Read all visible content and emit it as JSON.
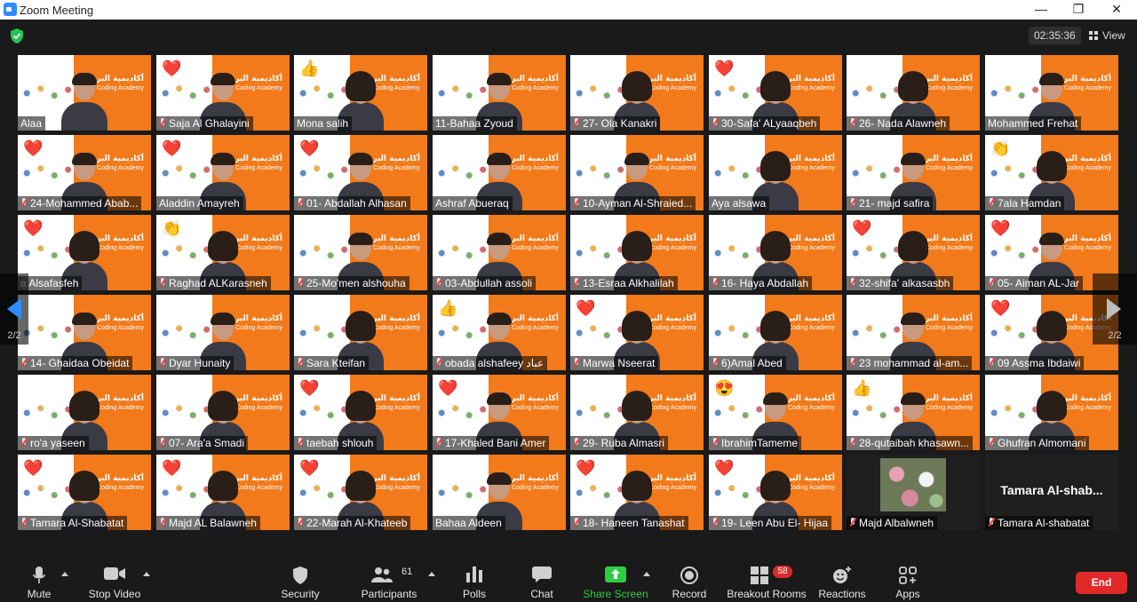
{
  "window": {
    "title": "Zoom Meeting",
    "minimize": "—",
    "maximize": "❐",
    "close": "✕"
  },
  "header": {
    "timer": "02:35:36",
    "view_label": "View"
  },
  "pager": {
    "page_label_left": "2/2",
    "page_label_right": "2/2"
  },
  "participants_grid": [
    [
      {
        "name": "Alaa",
        "muted": false,
        "reaction": ""
      },
      {
        "name": "Saja Al Ghalayini",
        "muted": true,
        "reaction": "❤️"
      },
      {
        "name": "Mona salih",
        "muted": false,
        "reaction": "👍",
        "hijab": true
      },
      {
        "name": "11-Bahaa Zyoud",
        "muted": false,
        "reaction": ""
      },
      {
        "name": "27- Ola Kanakri",
        "muted": true,
        "reaction": "",
        "hijab": true
      },
      {
        "name": "30-Safa' ALyaaqbeh",
        "muted": true,
        "reaction": "❤️",
        "hijab": true
      },
      {
        "name": "26- Nada Alawneh",
        "muted": true,
        "reaction": "",
        "hijab": true
      },
      {
        "name": "Mohammed Frehat",
        "muted": false,
        "reaction": ""
      }
    ],
    [
      {
        "name": "24-Mohammed Abab...",
        "muted": true,
        "reaction": "❤️"
      },
      {
        "name": "Aladdin Amayreh",
        "muted": false,
        "reaction": "❤️"
      },
      {
        "name": "01- Abdallah Alhasan",
        "muted": true,
        "reaction": "❤️"
      },
      {
        "name": "Ashraf Abueraq",
        "muted": false,
        "reaction": ""
      },
      {
        "name": "10-Ayman Al-Shraied...",
        "muted": true,
        "reaction": ""
      },
      {
        "name": "Aya alsawa",
        "muted": false,
        "reaction": "",
        "hijab": true
      },
      {
        "name": "21- majd safira",
        "muted": true,
        "reaction": ""
      },
      {
        "name": "7ala Hamdan",
        "muted": true,
        "reaction": "👏",
        "hijab": true
      }
    ],
    [
      {
        "name": "a Alsafasfeh",
        "muted": false,
        "reaction": "❤️",
        "hijab": true
      },
      {
        "name": "Raghad ALKarasneh",
        "muted": true,
        "reaction": "👏",
        "hijab": true
      },
      {
        "name": "25-Mo'men alshouha",
        "muted": true,
        "reaction": ""
      },
      {
        "name": "03-Abdullah assoli",
        "muted": true,
        "reaction": ""
      },
      {
        "name": "13-Esraa Alkhalilah",
        "muted": true,
        "reaction": "",
        "hijab": true
      },
      {
        "name": "16- Haya Abdallah",
        "muted": true,
        "reaction": "",
        "hijab": true
      },
      {
        "name": "32-shifa' alkasasbh",
        "muted": true,
        "reaction": "❤️",
        "hijab": true
      },
      {
        "name": "05- Aiman AL-Jar",
        "muted": true,
        "reaction": "❤️"
      }
    ],
    [
      {
        "name": "14- Ghaidaa Obeidat",
        "muted": true,
        "reaction": ""
      },
      {
        "name": "Dyar Hunaity",
        "muted": true,
        "reaction": ""
      },
      {
        "name": "Sara Kteifan",
        "muted": true,
        "reaction": "",
        "hijab": true
      },
      {
        "name": "obada alshafeey عباد",
        "muted": true,
        "reaction": "👍"
      },
      {
        "name": "Marwa Nseerat",
        "muted": true,
        "reaction": "❤️",
        "hijab": true
      },
      {
        "name": "6)Amal Abed",
        "muted": true,
        "reaction": "",
        "hijab": true
      },
      {
        "name": "23 mohammad al-am...",
        "muted": true,
        "reaction": ""
      },
      {
        "name": "09 Assma Ibdaiwi",
        "muted": true,
        "reaction": "❤️",
        "hijab": true
      }
    ],
    [
      {
        "name": "ro'a yaseen",
        "muted": true,
        "reaction": "",
        "hijab": true
      },
      {
        "name": "07- Ara'a Smadi",
        "muted": true,
        "reaction": "",
        "hijab": true
      },
      {
        "name": "taebah shlouh",
        "muted": true,
        "reaction": "❤️",
        "hijab": true
      },
      {
        "name": "17-Khaled Bani Amer",
        "muted": true,
        "reaction": "❤️"
      },
      {
        "name": "29- Ruba Almasri",
        "muted": true,
        "reaction": "",
        "hijab": true
      },
      {
        "name": "IbrahimTameme",
        "muted": true,
        "reaction": "😍"
      },
      {
        "name": "28-qutaibah khasawn...",
        "muted": true,
        "reaction": "👍"
      },
      {
        "name": "Ghufran Almomani",
        "muted": true,
        "reaction": "",
        "hijab": true
      }
    ],
    [
      {
        "name": "Tamara Al-Shabatat",
        "muted": true,
        "reaction": "❤️",
        "hijab": true
      },
      {
        "name": "Majd AL Balawneh",
        "muted": true,
        "reaction": "❤️",
        "hijab": true
      },
      {
        "name": "22-Marah Al-Khateeb",
        "muted": true,
        "reaction": "❤️",
        "hijab": true
      },
      {
        "name": "Bahaa Aldeen",
        "muted": false,
        "reaction": ""
      },
      {
        "name": "18- Haneen Tanashat",
        "muted": true,
        "reaction": "❤️",
        "hijab": true
      },
      {
        "name": "19- Leen  Abu El- Hijaa",
        "muted": true,
        "reaction": "❤️",
        "hijab": true
      },
      {
        "name": "Majd Albalwneh",
        "muted": true,
        "reaction": "",
        "photo": true
      },
      {
        "name": "Tamara Al-shabatat",
        "muted": true,
        "reaction": "",
        "no_video": true,
        "display_name": "Tamara Al-shab..."
      }
    ]
  ],
  "tile_logo": {
    "arabic": "أكاديمية البرمجة",
    "english": "Coding Academy"
  },
  "toolbar": {
    "mute": "Mute",
    "stop_video": "Stop Video",
    "security": "Security",
    "participants": "Participants",
    "participants_count": "61",
    "polls": "Polls",
    "chat": "Chat",
    "share_screen": "Share Screen",
    "record": "Record",
    "breakout_rooms": "Breakout Rooms",
    "breakout_badge": "58",
    "reactions": "Reactions",
    "apps": "Apps",
    "end": "End"
  },
  "colors": {
    "accent_orange": "#f27a1a",
    "share_green": "#2ecc40",
    "end_red": "#e02828",
    "shield_green": "#23c552"
  },
  "icons": {
    "mute": "microphone-icon",
    "video": "video-camera-icon",
    "security": "shield-icon",
    "participants": "people-icon",
    "polls": "bar-chart-icon",
    "chat": "chat-bubble-icon",
    "share": "share-screen-icon",
    "record": "record-icon",
    "breakout": "breakout-rooms-icon",
    "reactions": "emoji-plus-icon",
    "apps": "apps-icon"
  }
}
